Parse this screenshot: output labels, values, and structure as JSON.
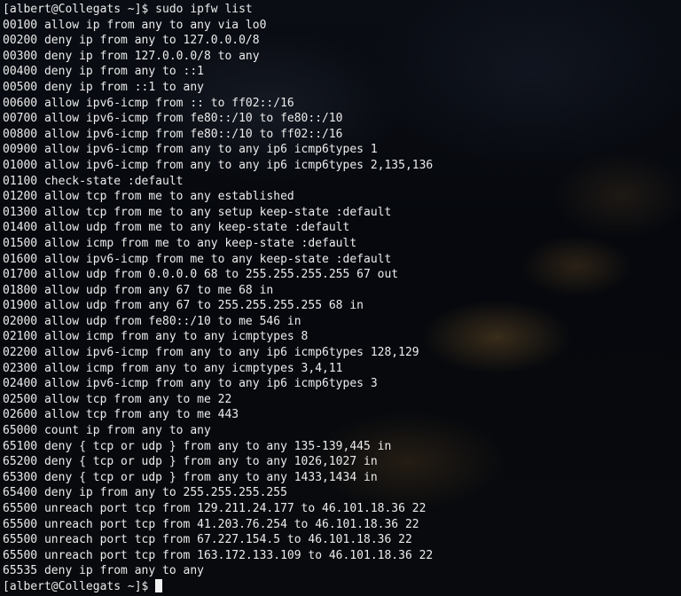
{
  "terminal": {
    "prompt_command": "[albert@Collegats ~]$ sudo ipfw list",
    "lines": [
      "00100 allow ip from any to any via lo0",
      "00200 deny ip from any to 127.0.0.0/8",
      "00300 deny ip from 127.0.0.0/8 to any",
      "00400 deny ip from any to ::1",
      "00500 deny ip from ::1 to any",
      "00600 allow ipv6-icmp from :: to ff02::/16",
      "00700 allow ipv6-icmp from fe80::/10 to fe80::/10",
      "00800 allow ipv6-icmp from fe80::/10 to ff02::/16",
      "00900 allow ipv6-icmp from any to any ip6 icmp6types 1",
      "01000 allow ipv6-icmp from any to any ip6 icmp6types 2,135,136",
      "01100 check-state :default",
      "01200 allow tcp from me to any established",
      "01300 allow tcp from me to any setup keep-state :default",
      "01400 allow udp from me to any keep-state :default",
      "01500 allow icmp from me to any keep-state :default",
      "01600 allow ipv6-icmp from me to any keep-state :default",
      "01700 allow udp from 0.0.0.0 68 to 255.255.255.255 67 out",
      "01800 allow udp from any 67 to me 68 in",
      "01900 allow udp from any 67 to 255.255.255.255 68 in",
      "02000 allow udp from fe80::/10 to me 546 in",
      "02100 allow icmp from any to any icmptypes 8",
      "02200 allow ipv6-icmp from any to any ip6 icmp6types 128,129",
      "02300 allow icmp from any to any icmptypes 3,4,11",
      "02400 allow ipv6-icmp from any to any ip6 icmp6types 3",
      "02500 allow tcp from any to me 22",
      "02600 allow tcp from any to me 443",
      "65000 count ip from any to any",
      "65100 deny { tcp or udp } from any to any 135-139,445 in",
      "65200 deny { tcp or udp } from any to any 1026,1027 in",
      "65300 deny { tcp or udp } from any to any 1433,1434 in",
      "65400 deny ip from any to 255.255.255.255",
      "65500 unreach port tcp from 129.211.24.177 to 46.101.18.36 22",
      "65500 unreach port tcp from 41.203.76.254 to 46.101.18.36 22",
      "65500 unreach port tcp from 67.227.154.5 to 46.101.18.36 22",
      "65500 unreach port tcp from 163.172.133.109 to 46.101.18.36 22",
      "65535 deny ip from any to any"
    ],
    "final_prompt": "[albert@Collegats ~]$ "
  }
}
